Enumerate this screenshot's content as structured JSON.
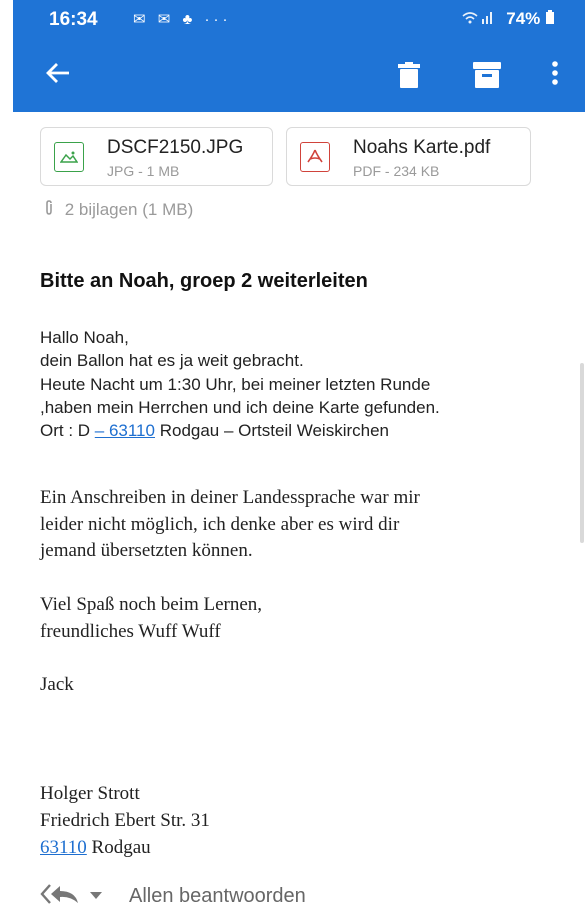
{
  "status_bar": {
    "time": "16:34",
    "icons": "✉ ✉ ♣ ···",
    "battery": "74%"
  },
  "app_bar": {
    "back_icon": "arrow-left-icon",
    "actions": [
      "trash-icon",
      "archive-icon",
      "more-vert-icon"
    ]
  },
  "attachments": [
    {
      "name": "DSCF2150.JPG",
      "meta": "JPG - 1 MB",
      "icon": "image-file-icon"
    },
    {
      "name": "Noahs Karte.pdf",
      "meta": "PDF - 234 KB",
      "icon": "pdf-file-icon"
    }
  ],
  "attachment_summary": "2 bijlagen (1 MB)",
  "subject": "Bitte an Noah, groep 2 weiterleiten",
  "body": {
    "line1": "Hallo Noah,",
    "line2": "dein Ballon hat es ja weit gebracht.",
    "line3": "Heute Nacht um 1:30 Uhr, bei meiner letzten Runde",
    "line4": ",haben mein Herrchen und ich deine Karte gefunden.",
    "line5_prefix": "Ort : D ",
    "line5_link": "– 63110",
    "line5_suffix": " Rodgau – Ortsteil Weiskirchen",
    "para2_line1": "Ein Anschreiben in deiner Landessprache war mir",
    "para2_line2": "leider nicht möglich, ich denke aber es wird dir",
    "para2_line3": "jemand übersetzten können.",
    "para3_line1": "Viel Spaß noch beim Lernen,",
    "para3_line2": "freundliches Wuff Wuff",
    "sign": "Jack",
    "sig_name": "Holger Strott",
    "sig_street": "Friedrich Ebert Str. 31",
    "sig_zip_link": "63110",
    "sig_city": " Rodgau"
  },
  "bottom_bar": {
    "reply_all_label": "Allen beantwoorden"
  },
  "colors": {
    "brand_blue": "#1f74d6",
    "link": "#1e6fd0",
    "jpg_green": "#3aa24a",
    "pdf_red": "#d0433b"
  }
}
